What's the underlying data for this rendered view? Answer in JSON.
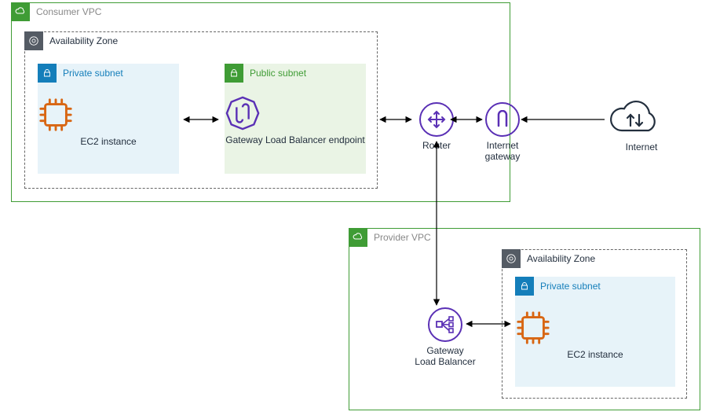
{
  "consumer_vpc": {
    "title": "Consumer VPC",
    "az_title": "Availability Zone",
    "private_subnet": {
      "title": "Private subnet",
      "node_label": "EC2 instance"
    },
    "public_subnet": {
      "title": "Public subnet",
      "node_label": "Gateway Load Balancer endpoint"
    }
  },
  "provider_vpc": {
    "title": "Provider VPC",
    "az_title": "Availability Zone",
    "private_subnet": {
      "title": "Private subnet",
      "node_label": "EC2 instance"
    },
    "glb_label_line1": "Gateway",
    "glb_label_line2": "Load Balancer"
  },
  "router_label": "Router",
  "igw_label_line1": "Internet",
  "igw_label_line2": "gateway",
  "internet_label": "Internet",
  "icons": {
    "vpc": "vpc-icon",
    "az": "availability-zone-icon",
    "private_subnet": "lock-icon",
    "public_subnet": "lock-icon",
    "ec2": "ec2-instance-icon",
    "glb_endpoint": "gateway-load-balancer-endpoint-icon",
    "router": "router-icon",
    "igw": "internet-gateway-icon",
    "internet": "internet-cloud-icon",
    "glb": "gateway-load-balancer-icon"
  },
  "colors": {
    "vpc_green": "#3F9C35",
    "az_gray": "#545B64",
    "subnet_blue": "#147EBA",
    "ec2_orange": "#D86613",
    "purple": "#5A30B5",
    "private_bg": "#E7F3F9",
    "public_bg": "#EAF4E5"
  }
}
